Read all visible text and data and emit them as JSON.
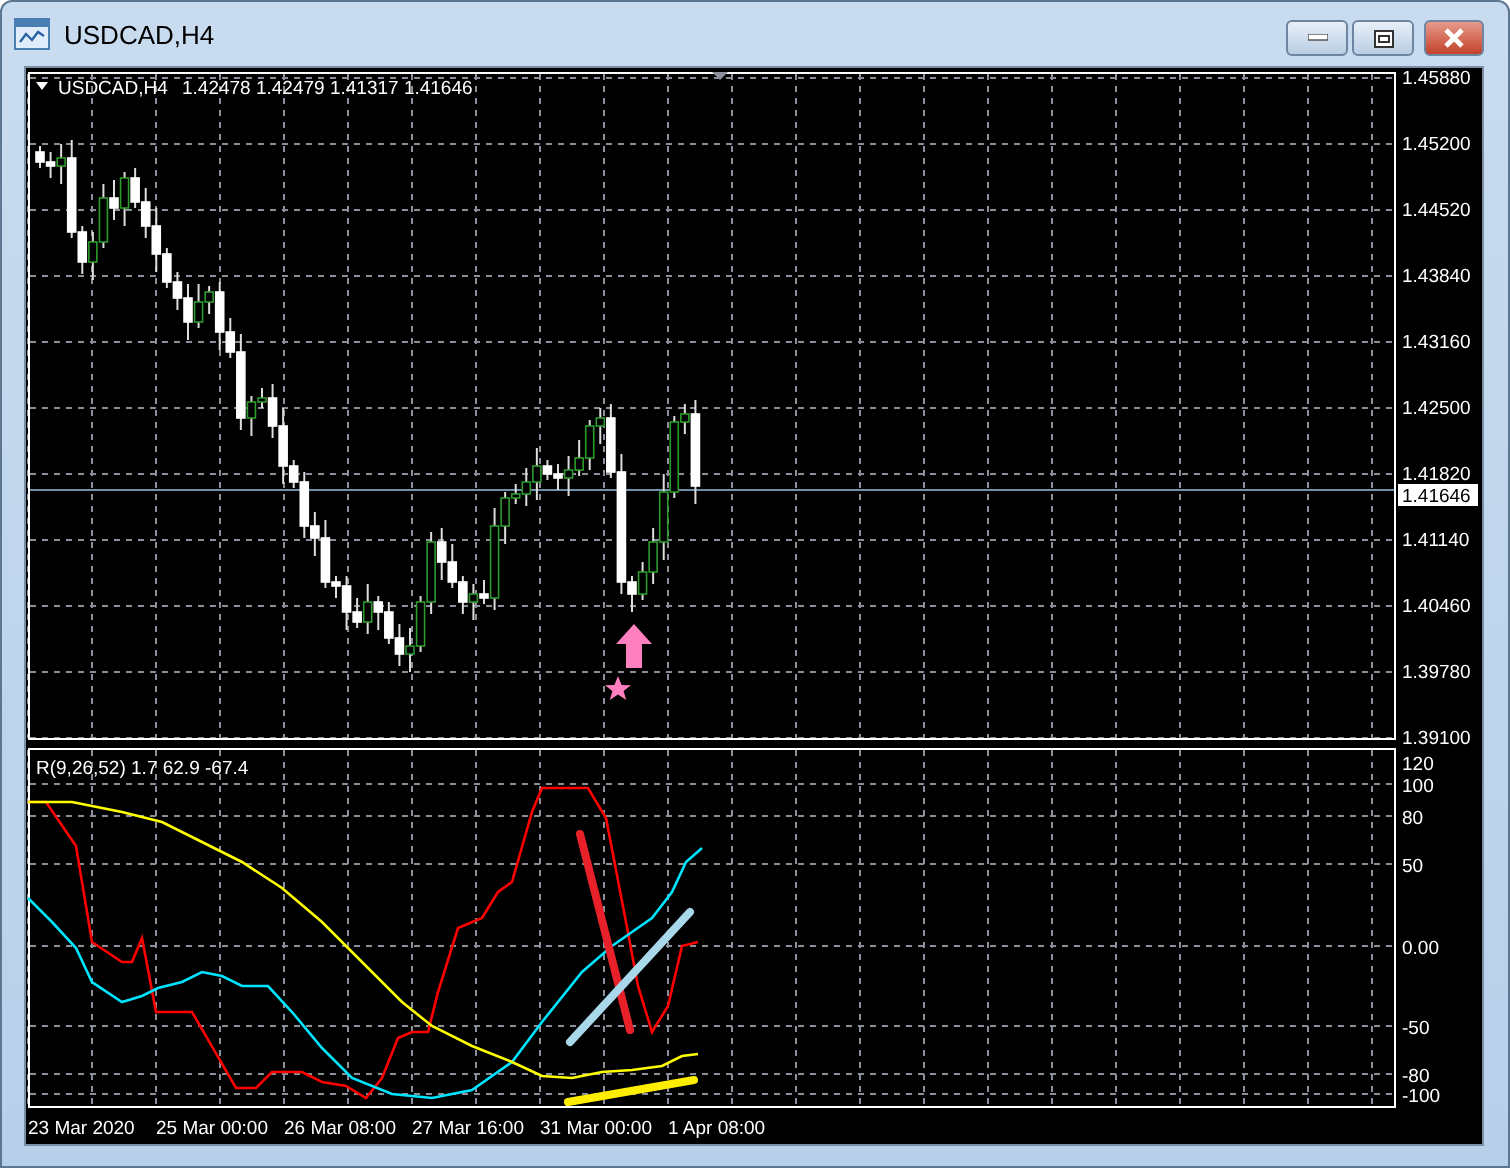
{
  "window": {
    "title": "USDCAD,H4"
  },
  "chart": {
    "symbol": "USDCAD,H4",
    "ohlc": "1.42478 1.42479 1.41317 1.41646",
    "price_axis": [
      "1.45880",
      "1.45200",
      "1.44520",
      "1.43840",
      "1.43160",
      "1.42500",
      "1.41820",
      "1.41140",
      "1.40460",
      "1.39780",
      "1.39100"
    ],
    "current_price": "1.41646",
    "indicator": {
      "label": "R(9,26,52) 1.7 62.9 -67.4",
      "axis": [
        "120",
        "100",
        "80",
        "50",
        "0.00",
        "-50",
        "-80",
        "-100"
      ]
    },
    "time_axis": [
      "23 Mar 2020",
      "25 Mar 00:00",
      "26 Mar 08:00",
      "27 Mar 16:00",
      "31 Mar 00:00",
      "1 Apr 08:00"
    ]
  }
}
